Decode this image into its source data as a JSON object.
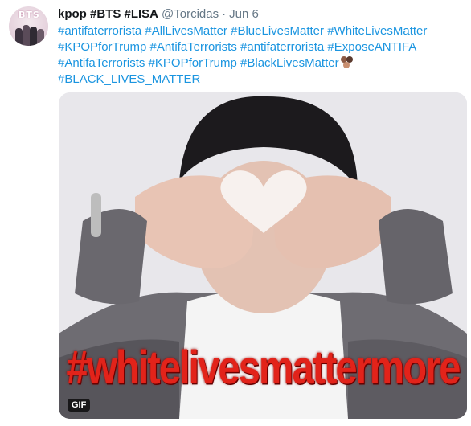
{
  "tweet": {
    "avatar_text": "BTS",
    "display_name": "kpop #BTS #LISA",
    "handle": "@Torcidas",
    "separator": "·",
    "date": "Jun 6",
    "text_lines": [
      [
        "#antifaterrorista",
        "#AllLivesMatter",
        "#BlueLivesMatter",
        "#WhiteLivesMatter"
      ],
      [
        "#KPOPforTrump",
        "#AntifaTerrorists",
        "#antifaterrorista",
        "#ExposeANTIFA"
      ],
      [
        "#AntifaTerrorists",
        "#KPOPforTrump",
        "#BlackLivesMatter"
      ],
      [
        "#BLACK_LIVES_MATTER"
      ]
    ],
    "emoji": "handshake-skin-tones-icon",
    "media": {
      "badge": "GIF",
      "caption": "#whitelivesmattermore"
    }
  },
  "colors": {
    "link": "#1b95e0",
    "name": "#14171a",
    "meta": "#657786",
    "caption": "#e2231a"
  }
}
